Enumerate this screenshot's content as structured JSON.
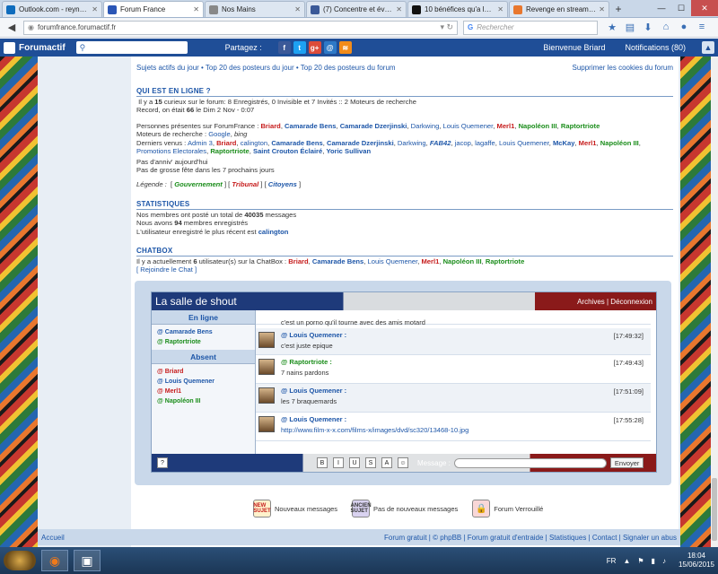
{
  "browser": {
    "tabs": [
      {
        "label": "Outlook.com - reynal…",
        "color": "#0f6cbd",
        "active": false
      },
      {
        "label": "Forum France",
        "color": "#2a56b6",
        "active": true
      },
      {
        "label": "Nos Mains",
        "color": "#888888",
        "active": false
      },
      {
        "label": "(7) Concentre et évén…",
        "color": "#3b5998",
        "active": false
      },
      {
        "label": "10 bénéfices qu'a le …",
        "color": "#111111",
        "active": false
      },
      {
        "label": "Revenge en streaming…",
        "color": "#e8772e",
        "active": false
      }
    ],
    "url": "forumfrance.forumactif.fr",
    "search_placeholder": "Rechercher"
  },
  "forumbar": {
    "logo": "Forumactif",
    "partagez": "Partagez :",
    "welcome": "Bienvenue Briard",
    "notifications": "Notifications (80)"
  },
  "toplinks": {
    "left": "Sujets actifs du jour • Top 20 des posteurs du jour • Top 20 des posteurs du forum",
    "right": "Supprimer les cookies du forum"
  },
  "online": {
    "heading": "QUI EST EN LIGNE ?",
    "line1_pre": "Il y a ",
    "line1_num": "15",
    "line1_post": " curieux sur le forum: 8 Enregistrés, 0 Invisible et 7 Invités :: 2 Moteurs de recherche",
    "record_pre": "Record, on était ",
    "record_num": "66",
    "record_post": " le Dim 2 Nov - 0:07",
    "present_label": "Personnes présentes sur ForumFrance : ",
    "present_users": [
      {
        "name": "Briard",
        "cls": "red"
      },
      {
        "name": "Camarade Bens",
        "cls": "blu"
      },
      {
        "name": "Camarade Dzerjinski",
        "cls": "blu"
      },
      {
        "name": "Darkwing",
        "cls": "blun"
      },
      {
        "name": "Louis Quemener",
        "cls": "blun"
      },
      {
        "name": "Merl1",
        "cls": "red"
      },
      {
        "name": "Napoléon III",
        "cls": "grn"
      },
      {
        "name": "Raptortriote",
        "cls": "grn"
      }
    ],
    "bots_label": "Moteurs de recherche : ",
    "bot1": "Google",
    "bot2": "bing",
    "last_label": "Derniers venus : ",
    "last_users": [
      {
        "name": "Admin 3",
        "cls": "blun"
      },
      {
        "name": "Briard",
        "cls": "red"
      },
      {
        "name": "calington",
        "cls": "blun"
      },
      {
        "name": "Camarade Bens",
        "cls": "blu"
      },
      {
        "name": "Camarade Dzerjinski",
        "cls": "blu"
      },
      {
        "name": "Darkwing",
        "cls": "blun"
      },
      {
        "name": "FAB42",
        "cls": "blu ital"
      },
      {
        "name": "jacop",
        "cls": "blun"
      },
      {
        "name": "lagaffe",
        "cls": "blun"
      },
      {
        "name": "Louis Quemener",
        "cls": "blun"
      },
      {
        "name": "McKay",
        "cls": "blu"
      },
      {
        "name": "Merl1",
        "cls": "red"
      },
      {
        "name": "Napoléon III",
        "cls": "grn"
      },
      {
        "name": "Promotions Electorales",
        "cls": "blun"
      },
      {
        "name": "Raptortriote",
        "cls": "grn"
      },
      {
        "name": "Saint Crouton Éclairé",
        "cls": "blu"
      },
      {
        "name": "Yoric Sullivan",
        "cls": "blu"
      }
    ],
    "birthday1": "Pas d'anniv' aujourd'hui",
    "birthday2": "Pas de grosse fête dans les 7 prochains jours",
    "legend_label": "Légende :",
    "legend_gouv": "Gouvernement",
    "legend_trib": "Tribunal",
    "legend_cit": "Citoyens"
  },
  "stats": {
    "heading": "STATISTIQUES",
    "l1_pre": "Nos membres ont posté un total de ",
    "l1_num": "40035",
    "l1_post": " messages",
    "l2_pre": "Nous avons ",
    "l2_num": "94",
    "l2_post": " membres enregistrés",
    "l3_pre": "L'utilisateur enregistré le plus récent est ",
    "l3_user": "calington"
  },
  "chatbox": {
    "heading": "CHATBOX",
    "line_pre": "Il y a actuellement ",
    "line_num": "6",
    "line_post": " utilisateur(s) sur la ChatBox : ",
    "users": [
      {
        "name": "Briard",
        "cls": "red"
      },
      {
        "name": "Camarade Bens",
        "cls": "blu"
      },
      {
        "name": "Louis Quemener",
        "cls": "blun"
      },
      {
        "name": "Merl1",
        "cls": "red"
      },
      {
        "name": "Napoléon III",
        "cls": "grn"
      },
      {
        "name": "Raptortriote",
        "cls": "grn"
      }
    ],
    "join": "[ Rejoindre le Chat ]",
    "title": "La salle de shout",
    "archives": "Archives | Déconnexion",
    "online_label": "En ligne",
    "online_users": [
      {
        "name": "@ Camarade Bens",
        "cls": "blu"
      },
      {
        "name": "@ Raptortriote",
        "cls": "grn"
      }
    ],
    "absent_label": "Absent",
    "absent_users": [
      {
        "name": "@ Briard",
        "cls": "red"
      },
      {
        "name": "@ Louis Quemener",
        "cls": "blun"
      },
      {
        "name": "@ Merl1",
        "cls": "red"
      },
      {
        "name": "@ Napoléon III",
        "cls": "grn"
      }
    ],
    "messages": [
      {
        "author": "",
        "time": "",
        "text": "c'est un porno qu'il tourne avec des amis motard",
        "cls": "blun"
      },
      {
        "author": "@ Louis Quemener :",
        "time": "[17:49:32]",
        "text": "c'est juste epique",
        "cls": "blun"
      },
      {
        "author": "@ Raptortriote :",
        "time": "[17:49:43]",
        "text": "7 nains pardons",
        "cls": "grn"
      },
      {
        "author": "@ Louis Quemener :",
        "time": "[17:51:09]",
        "text": "les 7 braquemards",
        "cls": "blun"
      },
      {
        "author": "@ Louis Quemener :",
        "time": "[17:55:28]",
        "text": "http://www.film-x-x.com/films-x/images/dvd/sc320/13468-10.jpg",
        "cls": "blun"
      }
    ],
    "msg_label": "Message :",
    "send": "Envoyer",
    "help": "?",
    "fmt": [
      "B",
      "I",
      "U",
      "S",
      "A",
      "☺"
    ]
  },
  "icon_legend": {
    "new": "Nouveaux messages",
    "new_icon": "NEW SUJET",
    "old": "Pas de nouveaux messages",
    "old_icon": "ANCIEN SUJET",
    "locked": "Forum Verrouillé"
  },
  "footer": {
    "left": "Accueil",
    "right": "Forum gratuit | © phpBB | Forum gratuit d'entraide | Statistiques | Contact | Signaler un abus"
  },
  "taskbar": {
    "lang": "FR",
    "time": "18:04",
    "date": "15/06/2015"
  }
}
